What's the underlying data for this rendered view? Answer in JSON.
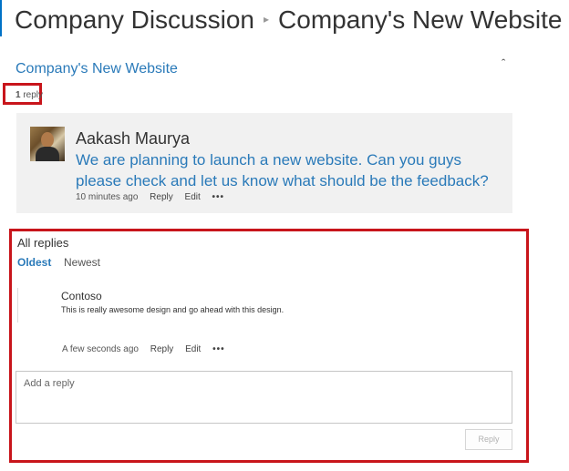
{
  "breadcrumb": {
    "parent": "Company Discussion",
    "separator": "▸",
    "current": "Company's New Website"
  },
  "thread": {
    "title": "Company's New Website",
    "reply_count_number": "1",
    "reply_count_label": " reply"
  },
  "post": {
    "author": "Aakash Maurya",
    "body": "We are planning to launch a new website. Can you guys please check and let us know what should be the feedback?",
    "timestamp": "10 minutes ago",
    "reply_label": "Reply",
    "edit_label": "Edit",
    "more_label": "•••"
  },
  "replies": {
    "heading": "All replies",
    "sort_oldest": "Oldest",
    "sort_newest": "Newest",
    "items": [
      {
        "author": "Contoso",
        "body": "This is really awesome design and go ahead with this design.",
        "timestamp": "A few seconds ago",
        "reply_label": "Reply",
        "edit_label": "Edit",
        "more_label": "•••"
      }
    ],
    "input_placeholder": "Add a reply",
    "submit_label": "Reply"
  },
  "icons": {
    "collapse": "chevron-up-icon",
    "more": "ellipsis-icon"
  },
  "colors": {
    "accent": "#2a7ab9",
    "highlight_border": "#c8151b",
    "post_background": "#f1f1f1"
  }
}
